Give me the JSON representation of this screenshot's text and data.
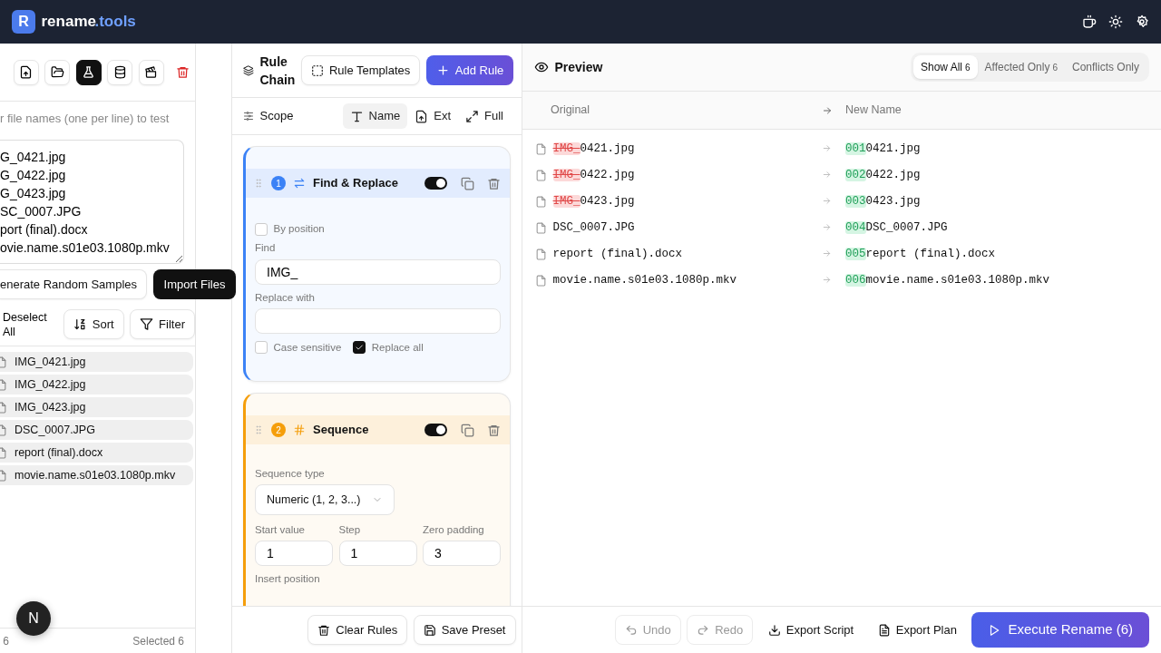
{
  "header": {
    "logo_letter": "R",
    "brand_name": "rename",
    "brand_suffix": ".tools",
    "actions": [
      {
        "kind": "coffee"
      },
      {
        "kind": "sun"
      },
      {
        "kind": "settings"
      }
    ]
  },
  "source_panel": {
    "toolbar": [
      {
        "kind": "upload",
        "selected": false
      },
      {
        "kind": "folder",
        "selected": false
      },
      {
        "kind": "flask",
        "selected": true
      },
      {
        "kind": "database",
        "selected": false
      },
      {
        "kind": "clapper",
        "selected": false
      },
      {
        "kind": "trash",
        "selected": false
      }
    ],
    "hint": "r file names (one per line) to test",
    "sample_lines": [
      "G_0421.jpg",
      "G_0422.jpg",
      "G_0423.jpg",
      "SC_0007.JPG",
      "port (final).docx",
      "ovie.name.s01e03.1080p.mkv"
    ],
    "generate_button": "enerate Random Samples",
    "import_button": "Import Files",
    "deselect": "Deselect All",
    "sort_button": "Sort",
    "filter_button": "Filter",
    "files": [
      {
        "name": "IMG_0421.jpg",
        "selected": true
      },
      {
        "name": "IMG_0422.jpg",
        "selected": true
      },
      {
        "name": "IMG_0423.jpg",
        "selected": true
      },
      {
        "name": "DSC_0007.JPG",
        "selected": true
      },
      {
        "name": "report (final).docx",
        "selected": true
      },
      {
        "name": "movie.name.s01e03.1080p.mkv",
        "selected": true
      }
    ],
    "footer_count": "6",
    "footer_selected": "Selected 6"
  },
  "dev_badge": "N",
  "rule_panel": {
    "title": "Rule Chain",
    "templates_button": "Rule Templates",
    "add_button": "Add Rule",
    "scope_label": "Scope",
    "scope_tabs": [
      {
        "label": "Name",
        "kind": "name",
        "selected": true
      },
      {
        "label": "Ext",
        "kind": "ext",
        "selected": false
      },
      {
        "label": "Full",
        "kind": "full",
        "selected": false
      }
    ],
    "rules": [
      {
        "kind": "find_replace",
        "number": "1",
        "title": "Find & Replace",
        "enabled": true,
        "color": "#3b82f6",
        "by_position": {
          "label": "By position",
          "checked": false
        },
        "find_label": "Find",
        "find_value": "IMG_",
        "replace_label": "Replace with",
        "options": [
          {
            "label": "Case sensitive",
            "checked": false
          },
          {
            "label": "Replace all",
            "checked": true
          }
        ]
      },
      {
        "kind": "sequence",
        "number": "2",
        "title": "Sequence",
        "enabled": true,
        "color": "#f59e0b",
        "type_label": "Sequence type",
        "type_value": "Numeric (1, 2, 3...)",
        "fields": [
          {
            "label": "Start value",
            "value": "1"
          },
          {
            "label": "Step",
            "value": "1"
          },
          {
            "label": "Zero padding",
            "value": "3"
          }
        ],
        "position_label": "Insert position"
      }
    ],
    "clear_button": "Clear Rules",
    "save_button": "Save Preset"
  },
  "preview": {
    "title": "Preview",
    "filters": [
      {
        "label": "Show All",
        "count": "6",
        "selected": true
      },
      {
        "label": "Affected Only",
        "count": "6",
        "selected": false
      },
      {
        "label": "Conflicts Only",
        "selected": false
      }
    ],
    "columns": [
      "Original",
      "New Name"
    ],
    "rows": [
      {
        "original": [
          {
            "text": "IMG_",
            "kind": "removed"
          },
          {
            "text": "0421.jpg",
            "kind": "same"
          }
        ],
        "new": [
          {
            "text": "001",
            "kind": "added"
          },
          {
            "text": "0421.jpg",
            "kind": "same"
          }
        ]
      },
      {
        "original": [
          {
            "text": "IMG_",
            "kind": "removed"
          },
          {
            "text": "0422.jpg",
            "kind": "same"
          }
        ],
        "new": [
          {
            "text": "002",
            "kind": "added"
          },
          {
            "text": "0422.jpg",
            "kind": "same"
          }
        ]
      },
      {
        "original": [
          {
            "text": "IMG_",
            "kind": "removed"
          },
          {
            "text": "0423.jpg",
            "kind": "same"
          }
        ],
        "new": [
          {
            "text": "003",
            "kind": "added"
          },
          {
            "text": "0423.jpg",
            "kind": "same"
          }
        ]
      },
      {
        "original": [
          {
            "text": "DSC_0007.JPG",
            "kind": "same"
          }
        ],
        "new": [
          {
            "text": "004",
            "kind": "added"
          },
          {
            "text": "DSC_0007.JPG",
            "kind": "same"
          }
        ]
      },
      {
        "original": [
          {
            "text": "report (final).docx",
            "kind": "same"
          }
        ],
        "new": [
          {
            "text": "005",
            "kind": "added"
          },
          {
            "text": "report (final).docx",
            "kind": "same"
          }
        ]
      },
      {
        "original": [
          {
            "text": "movie.name.s01e03.1080p.mkv",
            "kind": "same"
          }
        ],
        "new": [
          {
            "text": "006",
            "kind": "added"
          },
          {
            "text": "movie.name.s01e03.1080p.mkv",
            "kind": "same"
          }
        ]
      }
    ],
    "undo_button": {
      "label": "Undo",
      "disabled": true
    },
    "redo_button": {
      "label": "Redo",
      "disabled": true
    },
    "export_script": "Export Script",
    "export_plan": "Export Plan",
    "execute_button": "Execute Rename (6)"
  }
}
